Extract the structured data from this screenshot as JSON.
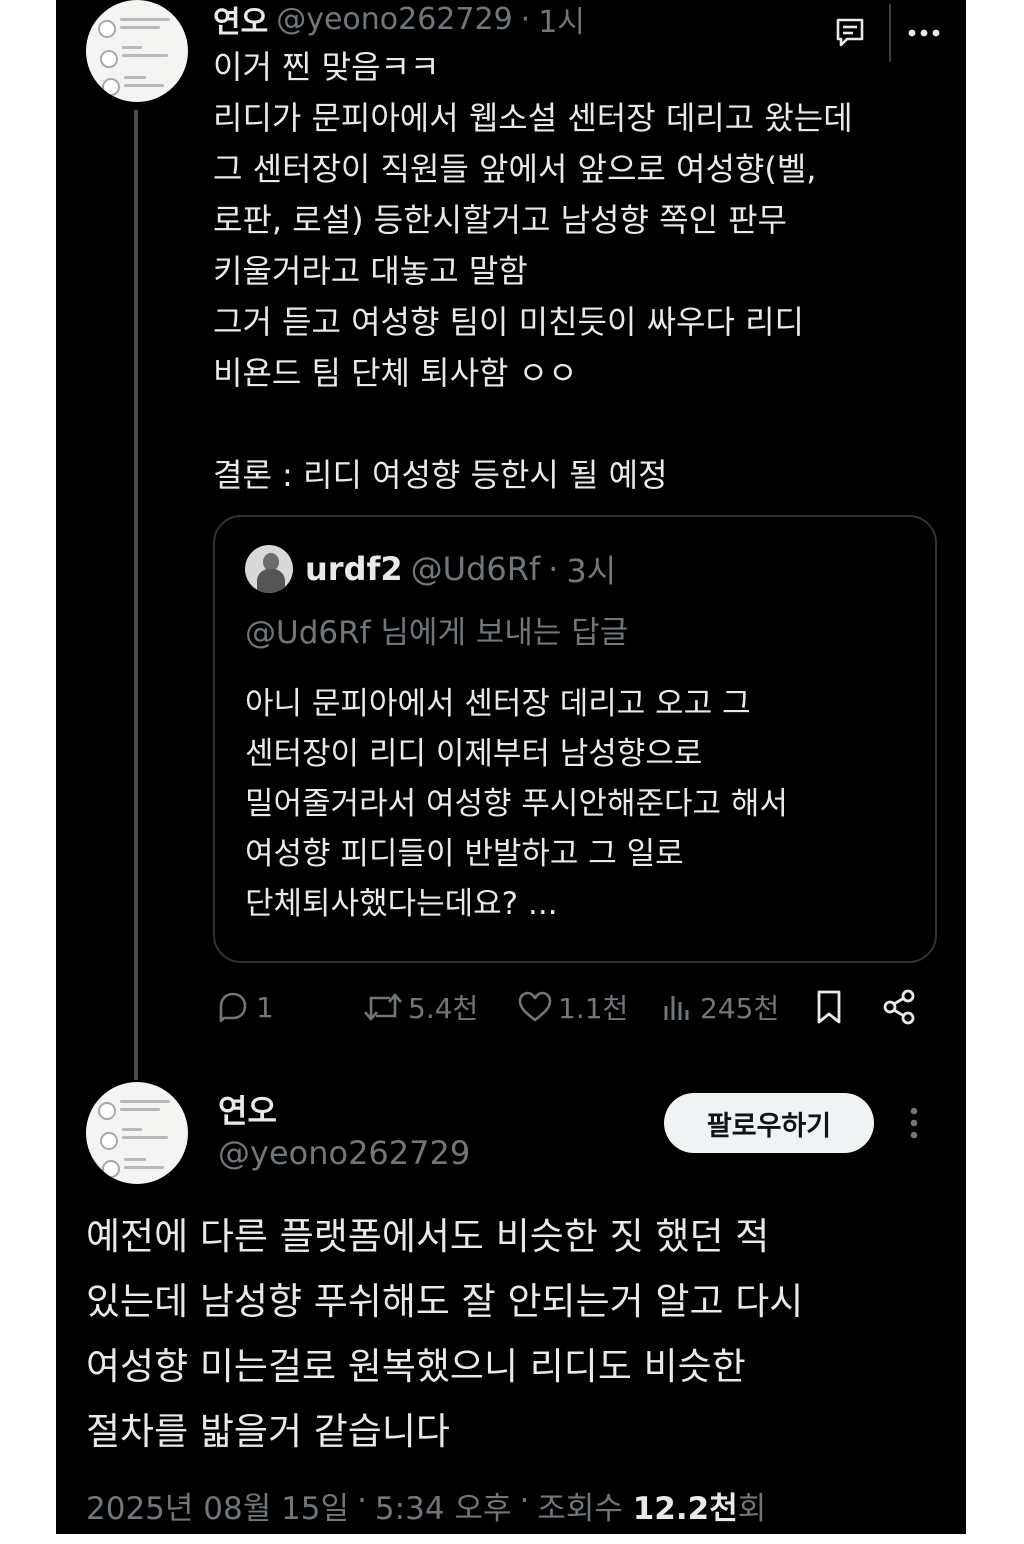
{
  "reply_tweet": {
    "display_name": "연오",
    "handle": "@yeono262729",
    "separator": "·",
    "time": "1시",
    "text": "이거 찐 맞음ㅋㅋ\n리디가 문피아에서 웹소설 센터장 데리고 왔는데\n그 센터장이 직원들 앞에서 앞으로 여성향(벨,\n로판, 로설) 등한시할거고 남성향 쪽인 판무\n키울거라고 대놓고 말함\n그거 듣고 여성향 팀이 미친듯이 싸우다 리디\n비욘드 팀 단체 퇴사함 ㅇㅇ\n\n결론 : 리디 여성향 등한시 될 예정",
    "icons": {
      "grok": "grok-icon",
      "more": "more-horizontal-icon"
    }
  },
  "quoted_tweet": {
    "display_name": "urdf2",
    "handle": "@Ud6Rf",
    "separator": "·",
    "time": "3시",
    "reply_context": "@Ud6Rf 님에게 보내는 답글",
    "text": "아니 문피아에서 센터장 데리고 오고 그\n센터장이 리디 이제부터 남성향으로\n밀어줄거라서 여성향 푸시안해준다고 해서\n여성향 피디들이 반발하고 그 일로\n단체퇴사했다는데요? ..."
  },
  "actions": {
    "replies": "1",
    "retweets": "5.4천",
    "likes": "1.1천",
    "views": "245천",
    "icons": [
      "reply-icon",
      "retweet-icon",
      "like-icon",
      "views-icon",
      "bookmark-icon",
      "share-icon"
    ]
  },
  "main_tweet": {
    "display_name": "연오",
    "handle": "@yeono262729",
    "follow_label": "팔로우하기",
    "text": "예전에 다른 플랫폼에서도 비슷한 짓 했던 적\n있는데 남성향 푸쉬해도 잘 안되는거 알고 다시\n여성향 미는걸로 원복했으니 리디도 비슷한\n절차를 밟을거 같습니다",
    "date": "2025년 08월 15일",
    "separator": "·",
    "time": "5:34 오후",
    "views_label": "조회수",
    "views_count": "12.2천",
    "views_suffix": "회"
  },
  "colors": {
    "background": "#000000",
    "text": "#e7e9ea",
    "muted": "#71767b",
    "border": "#2f3336",
    "button_bg": "#eff3f4"
  }
}
